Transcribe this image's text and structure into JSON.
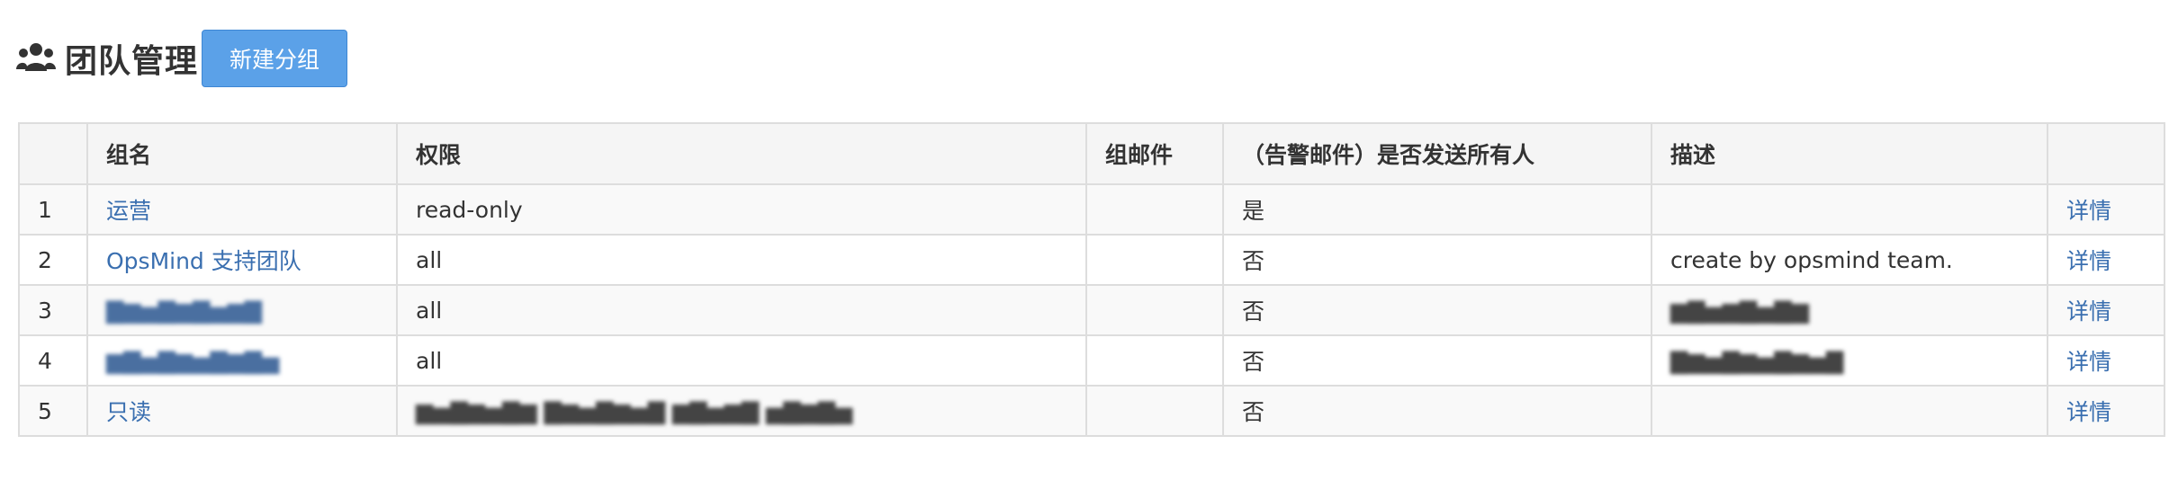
{
  "header": {
    "title": "团队管理",
    "new_group_label": "新建分组"
  },
  "table": {
    "columns": [
      "",
      "组名",
      "权限",
      "组邮件",
      "（告警邮件）是否发送所有人",
      "描述",
      ""
    ],
    "rows": [
      {
        "index": "1",
        "name": "运营",
        "permission": "read-only",
        "email": "",
        "send_all": "是",
        "description": "",
        "detail": "详情"
      },
      {
        "index": "2",
        "name": "OpsMind 支持团队",
        "permission": "all",
        "email": "",
        "send_all": "否",
        "description": "create by opsmind team.",
        "detail": "详情"
      },
      {
        "index": "3",
        "name": "",
        "permission": "all",
        "email": "",
        "send_all": "否",
        "description": "",
        "detail": "详情"
      },
      {
        "index": "4",
        "name": "",
        "permission": "all",
        "email": "",
        "send_all": "否",
        "description": "",
        "detail": "详情"
      },
      {
        "index": "5",
        "name": "只读",
        "permission": "",
        "email": "",
        "send_all": "否",
        "description": "",
        "detail": "详情"
      }
    ]
  }
}
